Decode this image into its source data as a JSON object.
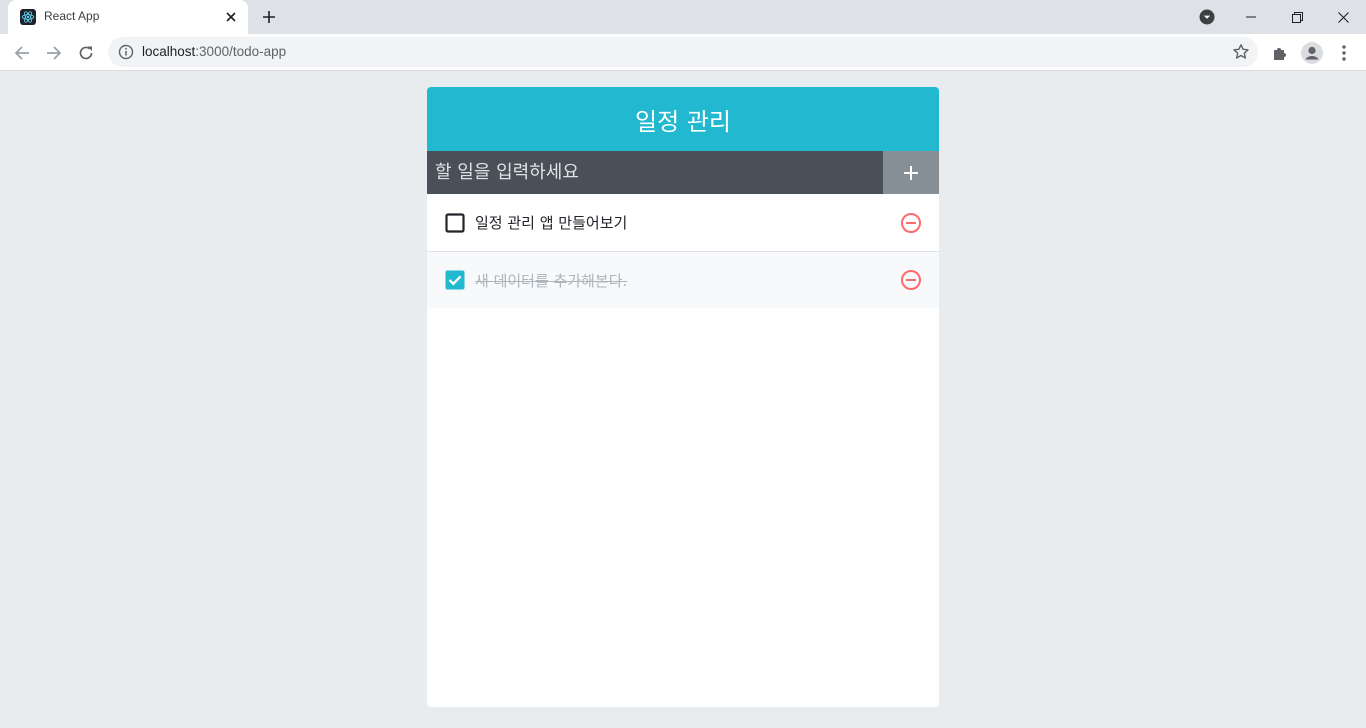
{
  "browser": {
    "tab_title": "React App",
    "url_host": "localhost",
    "url_path": ":3000/todo-app"
  },
  "app": {
    "title": "일정 관리",
    "insert": {
      "placeholder": "할 일을 입력하세요",
      "value": ""
    },
    "todos": [
      {
        "text": "일정 관리 앱 만들어보기",
        "checked": false
      },
      {
        "text": "새 데이터를 추가해본다.",
        "checked": true
      }
    ]
  },
  "colors": {
    "header": "#22b8cf",
    "form": "#495057",
    "add_button": "#868e96",
    "remove": "#ff6b6b",
    "checked": "#22b8cf"
  },
  "icons": {
    "tab_favicon": "react-logo-icon",
    "tab_close": "close-icon",
    "new_tab": "plus-icon",
    "back": "arrow-left-icon",
    "forward": "arrow-right-icon",
    "reload": "reload-icon",
    "info": "info-icon",
    "bookmark": "star-icon",
    "extensions": "puzzle-icon",
    "profile": "account-icon",
    "menu": "kebab-menu-icon",
    "add": "plus-icon",
    "unchecked": "checkbox-blank-icon",
    "checked": "checkbox-checked-icon",
    "remove": "minus-circle-icon"
  }
}
